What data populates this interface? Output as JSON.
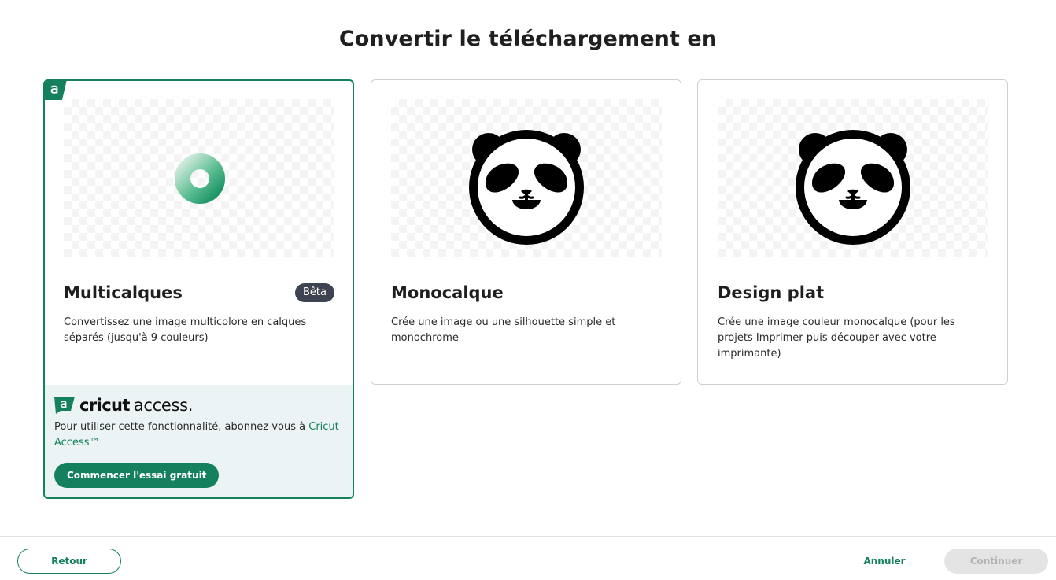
{
  "page": {
    "title": "Convertir le téléchargement en"
  },
  "options": [
    {
      "title": "Multicalques",
      "badge": "Bêta",
      "description": "Convertissez une image multicolore en calques séparés (jusqu'à 9 couleurs)",
      "selected": true,
      "preview": "loading-spinner",
      "access": {
        "logo_word_1": "cricut",
        "logo_word_2": "access.",
        "text_before_link": "Pour utiliser cette fonctionnalité, abonnez-vous à ",
        "link_text": "Cricut Access™",
        "button_label": "Commencer l'essai gratuit"
      }
    },
    {
      "title": "Monocalque",
      "description": "Crée une image ou une silhouette simple et monochrome",
      "selected": false,
      "preview": "panda-icon"
    },
    {
      "title": "Design plat",
      "description": "Crée une image couleur monocalque (pour les projets Imprimer puis découper avec votre imprimante)",
      "selected": false,
      "preview": "panda-icon"
    }
  ],
  "footer": {
    "back_label": "Retour",
    "cancel_label": "Annuler",
    "continue_label": "Continuer"
  },
  "colors": {
    "accent": "#14805e",
    "badge": "#3d4350",
    "access_panel": "#ecf3f4",
    "disabled": "#e4e4e4"
  }
}
